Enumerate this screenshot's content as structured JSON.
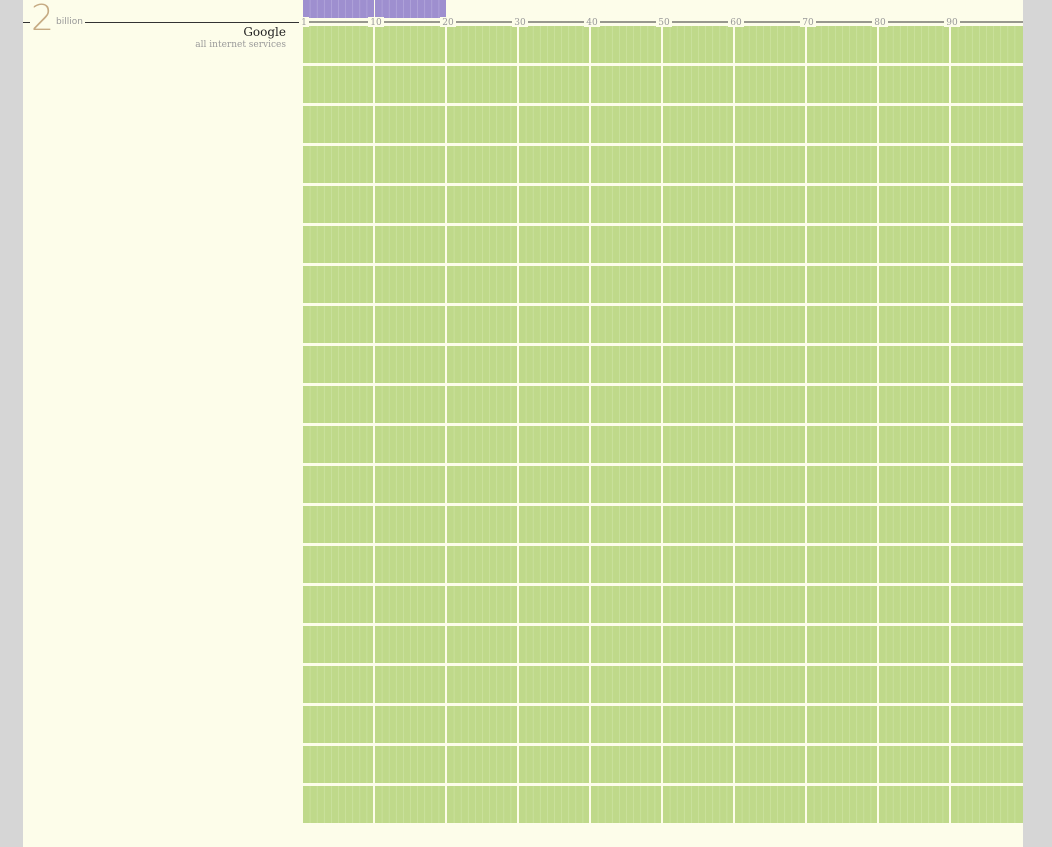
{
  "header": {
    "big_number": "2",
    "unit": "billion",
    "company": "Google",
    "subtitle": "all internet services"
  },
  "colors": {
    "background": "#fdfdea",
    "accent_number": "#c6ab83",
    "green_block": "#bfd98a",
    "purple_block": "#9e8fcf"
  },
  "chart_data": {
    "type": "unit-grid",
    "x_ticks": [
      "1",
      "10",
      "20",
      "30",
      "40",
      "50",
      "60",
      "70",
      "80",
      "90"
    ],
    "rows": 20,
    "columns_per_row": 10,
    "purple_blocks_above": 2
  }
}
